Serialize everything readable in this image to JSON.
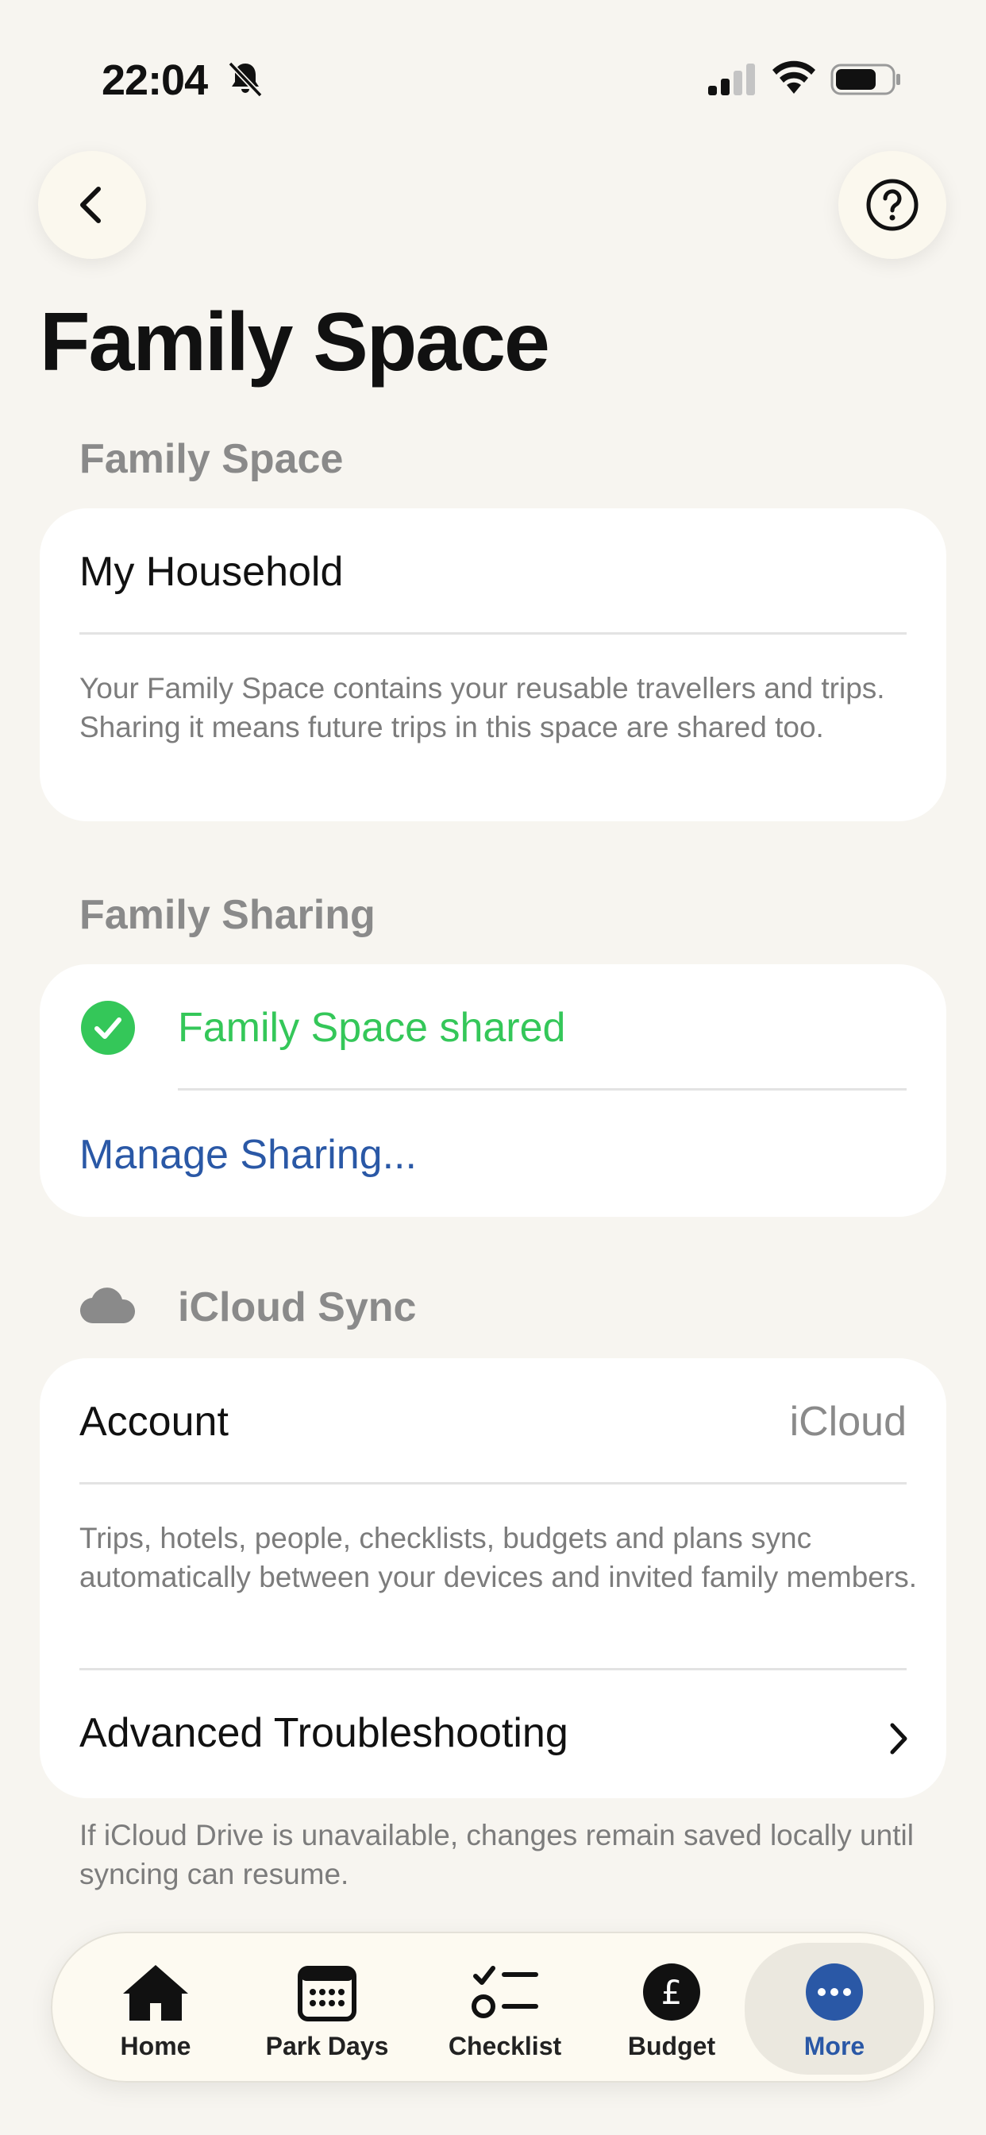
{
  "status": {
    "time": "22:04"
  },
  "page": {
    "title": "Family Space"
  },
  "family_space": {
    "header": "Family Space",
    "name": "My Household",
    "footnote": "Your Family Space contains your reusable travellers and trips. Sharing it means future trips in this space are shared too."
  },
  "family_sharing": {
    "header": "Family Sharing",
    "status": "Family Space shared",
    "manage_label": "Manage Sharing..."
  },
  "icloud": {
    "header": "iCloud Sync",
    "account_label": "Account",
    "account_value": "iCloud",
    "footnote": "Trips, hotels, people, checklists, budgets and plans sync automatically between your devices and invited family members.",
    "troubleshooting_label": "Advanced Troubleshooting",
    "bottom_note": "If iCloud Drive is unavailable, changes remain saved locally until syncing can resume."
  },
  "tabs": [
    {
      "label": "Home",
      "icon": "house-icon"
    },
    {
      "label": "Park Days",
      "icon": "calendar-icon"
    },
    {
      "label": "Checklist",
      "icon": "checklist-icon"
    },
    {
      "label": "Budget",
      "icon": "pound-icon"
    },
    {
      "label": "More",
      "icon": "ellipsis-icon"
    }
  ],
  "colors": {
    "background": "#f7f5f0",
    "accent_blue": "#2a58a6",
    "success_green": "#34c759",
    "secondary_text": "#8a8a8a"
  }
}
